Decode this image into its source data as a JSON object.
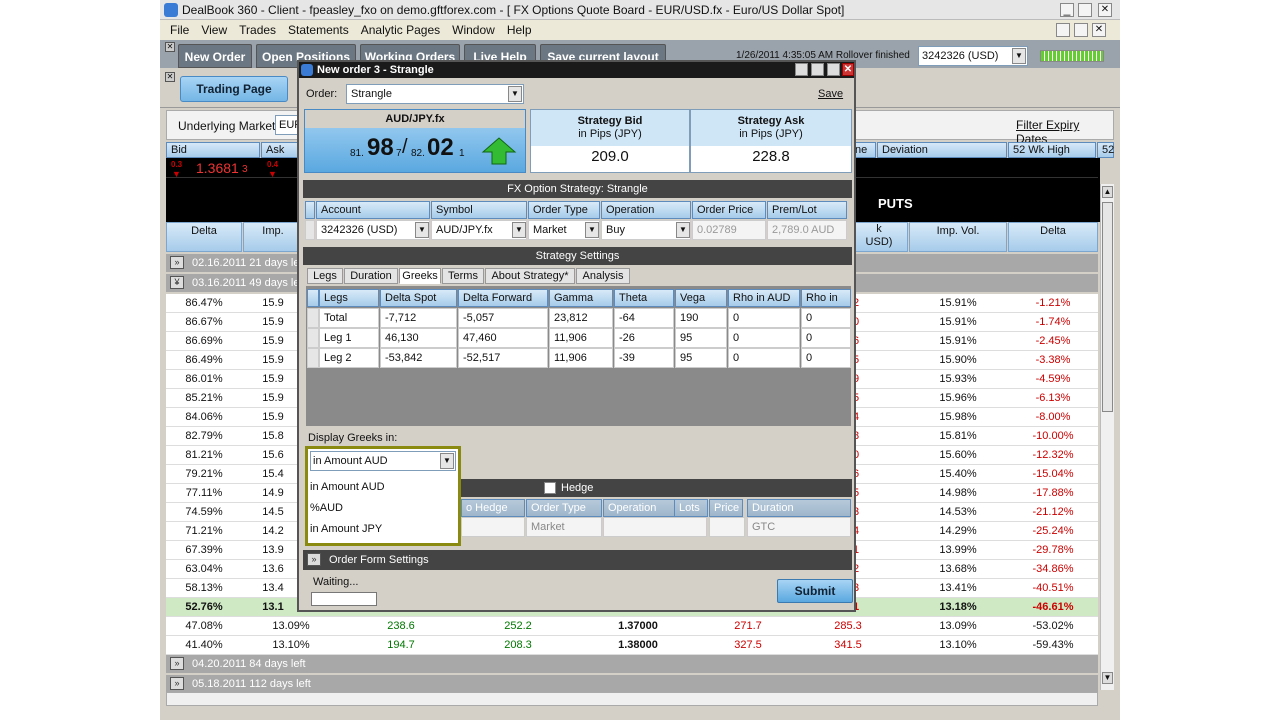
{
  "window": {
    "title": "DealBook 360 - Client - fpeasley_fxo on demo.gftforex.com - [ FX Options Quote Board - EUR/USD.fx - Euro/US Dollar Spot]"
  },
  "menu": [
    "File",
    "View",
    "Trades",
    "Statements",
    "Analytic Pages",
    "Window",
    "Help"
  ],
  "toolbar": {
    "buttons": [
      "New Order",
      "Open Positions",
      "Working Orders",
      "Live Help",
      "Save current layout"
    ],
    "status": "1/26/2011 4:35:05 AM Rollover finished",
    "account": "3242326 (USD)"
  },
  "trading_page": "Trading Page",
  "underlying": {
    "label": "Underlying Market:",
    "value": "EUR",
    "filter": "Filter Expiry Dates"
  },
  "price_headers": {
    "bid": "Bid",
    "ask": "Ask",
    "change": "ne",
    "deviation": "Deviation",
    "wk_high": "52 Wk High",
    "wk_extra": "52"
  },
  "bid_price": {
    "small": "0.3",
    "value": "1.3681",
    "suffix": "3"
  },
  "ask_price": {
    "small": "0.4"
  },
  "puts": "PUTS",
  "left_cols": {
    "delta": "Delta",
    "imp": "Imp."
  },
  "right_cols": {
    "k": "k",
    "usd": "USD)",
    "impvol": "Imp. Vol.",
    "delta": "Delta"
  },
  "groups": [
    {
      "label": "02.16.2011 21 days le"
    },
    {
      "label": "03.16.2011 49 days le"
    }
  ],
  "groups_bottom": [
    {
      "label": "04.20.2011 84 days left"
    },
    {
      "label": "05.18.2011 112 days left"
    }
  ],
  "rows": [
    {
      "delta": "86.47%",
      "imp": "15.9",
      "r": "2",
      "iv": "15.91%",
      "pd": "-1.21%"
    },
    {
      "delta": "86.67%",
      "imp": "15.9",
      "r": "0",
      "iv": "15.91%",
      "pd": "-1.74%"
    },
    {
      "delta": "86.69%",
      "imp": "15.9",
      "r": "6",
      "iv": "15.91%",
      "pd": "-2.45%"
    },
    {
      "delta": "86.49%",
      "imp": "15.9",
      "r": "5",
      "iv": "15.90%",
      "pd": "-3.38%"
    },
    {
      "delta": "86.01%",
      "imp": "15.9",
      "r": "9",
      "iv": "15.93%",
      "pd": "-4.59%"
    },
    {
      "delta": "85.21%",
      "imp": "15.9",
      "r": "5",
      "iv": "15.96%",
      "pd": "-6.13%"
    },
    {
      "delta": "84.06%",
      "imp": "15.9",
      "r": "4",
      "iv": "15.98%",
      "pd": "-8.00%"
    },
    {
      "delta": "82.79%",
      "imp": "15.8",
      "r": "8",
      "iv": "15.81%",
      "pd": "-10.00%"
    },
    {
      "delta": "81.21%",
      "imp": "15.6",
      "r": "0",
      "iv": "15.60%",
      "pd": "-12.32%"
    },
    {
      "delta": "79.21%",
      "imp": "15.4",
      "r": "6",
      "iv": "15.40%",
      "pd": "-15.04%"
    },
    {
      "delta": "77.11%",
      "imp": "14.9",
      "r": "5",
      "iv": "14.98%",
      "pd": "-17.88%"
    },
    {
      "delta": "74.59%",
      "imp": "14.5",
      "r": "3",
      "iv": "14.53%",
      "pd": "-21.12%"
    },
    {
      "delta": "71.21%",
      "imp": "14.2",
      "r": "4",
      "iv": "14.29%",
      "pd": "-25.24%"
    },
    {
      "delta": "67.39%",
      "imp": "13.9",
      "r": "1",
      "iv": "13.99%",
      "pd": "-29.78%"
    },
    {
      "delta": "63.04%",
      "imp": "13.6",
      "r": "2",
      "iv": "13.68%",
      "pd": "-34.86%"
    },
    {
      "delta": "58.13%",
      "imp": "13.4",
      "r": "3",
      "iv": "13.41%",
      "pd": "-40.51%"
    },
    {
      "delta": "52.76%",
      "imp": "13.1",
      "r": "1",
      "iv": "13.18%",
      "pd": "-46.61%"
    }
  ],
  "full_rows": [
    {
      "delta": "47.08%",
      "imp": "13.09%",
      "c1": "238.6",
      "c2": "252.2",
      "strike": "1.37000",
      "p1": "271.7",
      "p2": "285.3",
      "iv": "13.09%",
      "pd": "-53.02%"
    },
    {
      "delta": "41.40%",
      "imp": "13.10%",
      "c1": "194.7",
      "c2": "208.3",
      "strike": "1.38000",
      "p1": "327.5",
      "p2": "341.5",
      "iv": "13.10%",
      "pd": "-59.43%"
    }
  ],
  "dialog": {
    "title": "New order 3 - Strangle",
    "order_label": "Order:",
    "order_value": "Strangle",
    "save": "Save",
    "symbol": "AUD/JPY.fx",
    "bid_small": "81.",
    "bid_big": "98",
    "bid_frac": "7",
    "sep": "/",
    "ask_small": "82.",
    "ask_big": "02",
    "ask_frac": "1",
    "strategy_bid": "Strategy Bid",
    "strategy_ask": "Strategy Ask",
    "pips_unit": "in Pips (JPY)",
    "sbid_value": "209.0",
    "sask_value": "228.8",
    "strategy_title": "FX Option Strategy: Strangle",
    "grid_headers": [
      "Account",
      "Symbol",
      "Order Type",
      "Operation",
      "Order Price",
      "Prem/Lot"
    ],
    "grid_values": [
      "3242326 (USD)",
      "AUD/JPY.fx",
      "Market",
      "Buy",
      "0.02789",
      "2,789.0 AUD"
    ],
    "settings_title": "Strategy Settings",
    "tabs": [
      "Legs",
      "Duration",
      "Greeks",
      "Terms",
      "About Strategy*",
      "Analysis"
    ],
    "greek_headers": [
      "Legs",
      "Delta Spot",
      "Delta Forward",
      "Gamma",
      "Theta",
      "Vega",
      "Rho in AUD",
      "Rho in JP"
    ],
    "greek_rows": [
      [
        "Total",
        "-7,712",
        "-5,057",
        "23,812",
        "-64",
        "190",
        "0",
        "0"
      ],
      [
        "Leg 1",
        "46,130",
        "47,460",
        "11,906",
        "-26",
        "95",
        "0",
        "0"
      ],
      [
        "Leg 2",
        "-53,842",
        "-52,517",
        "11,906",
        "-39",
        "95",
        "0",
        "0"
      ]
    ],
    "display_label": "Display Greeks in:",
    "display_value": "in Amount AUD",
    "display_options": [
      "in Amount AUD",
      "%AUD",
      "in Amount JPY"
    ],
    "hedge": "Hedge",
    "hedge_headers": [
      "o Hedge",
      "Order Type",
      "Operation",
      "Lots",
      "Price",
      "Duration"
    ],
    "hedge_values": [
      "Market",
      "GTC"
    ],
    "form_settings": "Order Form Settings",
    "waiting": "Waiting...",
    "submit": "Submit"
  }
}
